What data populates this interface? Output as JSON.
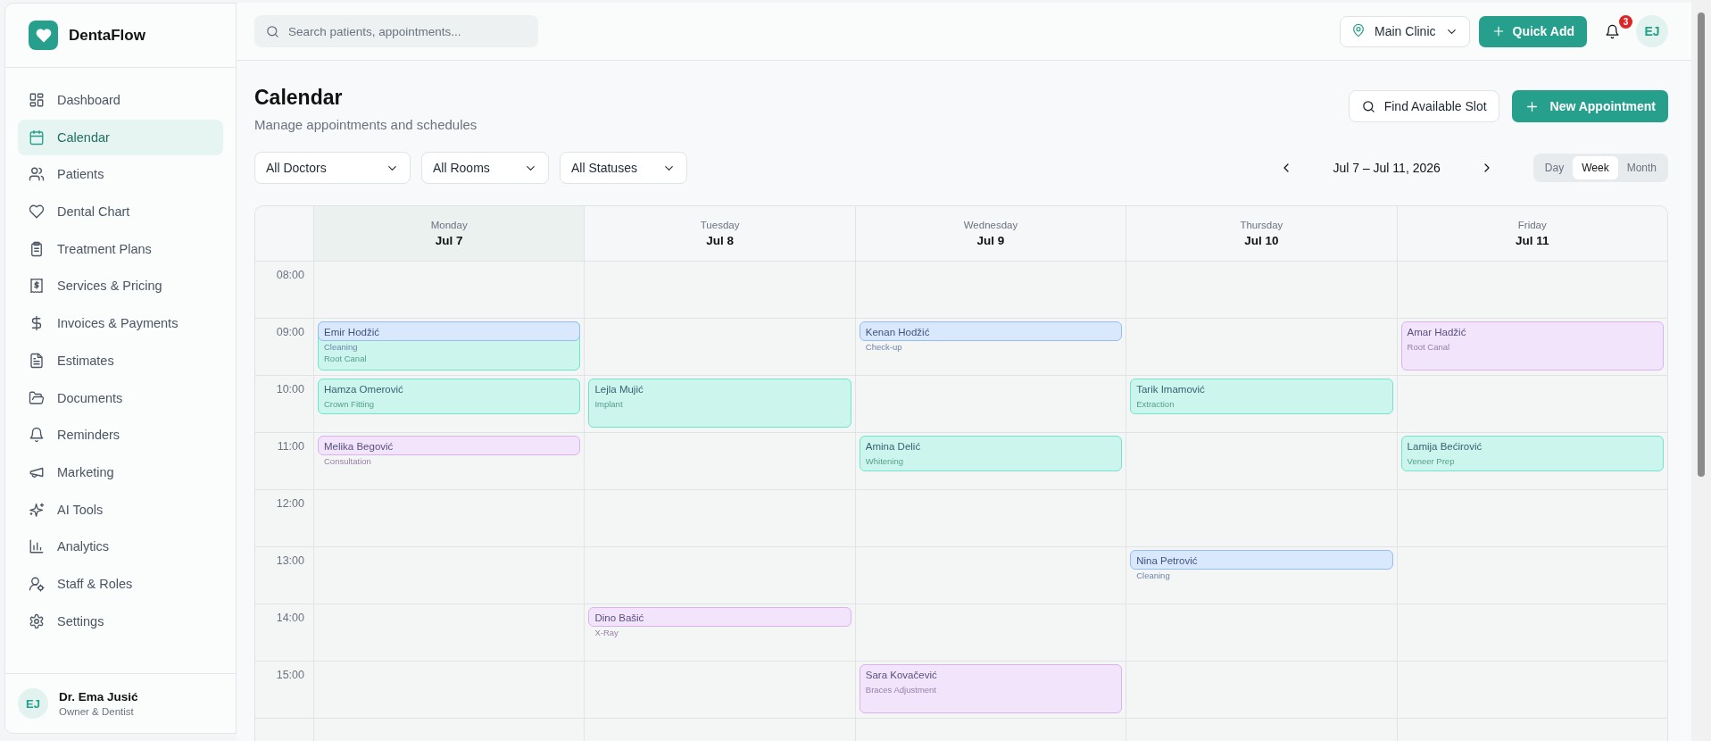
{
  "brand": {
    "name": "DentaFlow"
  },
  "sidebar": {
    "items": [
      {
        "label": "Dashboard",
        "selected": false
      },
      {
        "label": "Calendar",
        "selected": true
      },
      {
        "label": "Patients",
        "selected": false
      },
      {
        "label": "Dental Chart",
        "selected": false
      },
      {
        "label": "Treatment Plans",
        "selected": false
      },
      {
        "label": "Services & Pricing",
        "selected": false
      },
      {
        "label": "Invoices & Payments",
        "selected": false
      },
      {
        "label": "Estimates",
        "selected": false
      },
      {
        "label": "Documents",
        "selected": false
      },
      {
        "label": "Reminders",
        "selected": false
      },
      {
        "label": "Marketing",
        "selected": false
      },
      {
        "label": "AI Tools",
        "selected": false
      },
      {
        "label": "Analytics",
        "selected": false
      },
      {
        "label": "Staff & Roles",
        "selected": false
      },
      {
        "label": "Settings",
        "selected": false
      }
    ],
    "user": {
      "initials": "EJ",
      "name": "Dr. Ema Jusić",
      "role": "Owner & Dentist"
    }
  },
  "topbar": {
    "search": {
      "placeholder": "Search patients, appointments..."
    },
    "location": "Main Clinic",
    "quick_add": "Quick Add",
    "notifications": "3",
    "avatar": "EJ"
  },
  "page": {
    "title": "Calendar",
    "subtitle": "Manage appointments and schedules",
    "find_slot": "Find Available Slot",
    "new_appointment": "New Appointment"
  },
  "filters": [
    "All Doctors",
    "All Rooms",
    "All Statuses"
  ],
  "range": "Jul 7 – Jul 11, 2026",
  "views": [
    {
      "label": "Day",
      "selected": false
    },
    {
      "label": "Week",
      "selected": true
    },
    {
      "label": "Month",
      "selected": false
    }
  ],
  "days": [
    {
      "weekday": "Monday",
      "date": "Jul 7",
      "today": true
    },
    {
      "weekday": "Tuesday",
      "date": "Jul 8",
      "today": false
    },
    {
      "weekday": "Wednesday",
      "date": "Jul 9",
      "today": false
    },
    {
      "weekday": "Thursday",
      "date": "Jul 10",
      "today": false
    },
    {
      "weekday": "Friday",
      "date": "Jul 11",
      "today": false
    }
  ],
  "hours": [
    {
      "time": "08:00",
      "cells": [
        {},
        {},
        {},
        {},
        {}
      ]
    },
    {
      "time": "09:00",
      "cells": [
        {
          "appointments": [
            {
              "name": "Emir Hodžić",
              "service": "Cleaning",
              "color": "#93bdf7",
              "short": true,
              "long": false
            },
            {
              "service": "Root Canal",
              "color": "#6ee5cc",
              "short": false,
              "long": true
            }
          ]
        },
        {},
        {
          "appointments": [
            {
              "name": "Kenan Hodžić",
              "service": "Check-up",
              "color": "#93bdf7",
              "short": true,
              "long": false
            }
          ]
        },
        {},
        {
          "appointments": [
            {
              "name": "Amar Hadžić",
              "service": "Root Canal",
              "color": "#dab1f3",
              "short": false,
              "long": true
            }
          ]
        }
      ]
    },
    {
      "time": "10:00",
      "cells": [
        {
          "appointments": [
            {
              "name": "Hamza Omerović",
              "service": "Crown Fitting",
              "color": "#6ee5cc",
              "short": false,
              "long": false
            }
          ]
        },
        {
          "appointments": [
            {
              "name": "Lejla Mujić",
              "service": "Implant",
              "color": "#6ee5cc",
              "short": false,
              "long": true
            }
          ]
        },
        {},
        {
          "appointments": [
            {
              "name": "Tarik Imamović",
              "service": "Extraction",
              "color": "#6ee5cc",
              "short": false,
              "long": false
            }
          ]
        },
        {}
      ]
    },
    {
      "time": "11:00",
      "cells": [
        {
          "appointments": [
            {
              "name": "Melika Begović",
              "service": "Consultation",
              "color": "#dab1f3",
              "short": true,
              "long": false
            }
          ]
        },
        {},
        {
          "appointments": [
            {
              "name": "Amina Delić",
              "service": "Whitening",
              "color": "#6ee5cc",
              "short": false,
              "long": false
            }
          ]
        },
        {},
        {
          "appointments": [
            {
              "name": "Lamija Bećirović",
              "service": "Veneer Prep",
              "color": "#6ee5cc",
              "short": false,
              "long": false
            }
          ]
        }
      ]
    },
    {
      "time": "12:00",
      "cells": [
        {},
        {},
        {},
        {},
        {}
      ]
    },
    {
      "time": "13:00",
      "cells": [
        {},
        {},
        {},
        {
          "appointments": [
            {
              "name": "Nina Petrović",
              "service": "Cleaning",
              "color": "#93bdf7",
              "short": true,
              "long": false
            }
          ]
        },
        {}
      ]
    },
    {
      "time": "14:00",
      "cells": [
        {},
        {
          "appointments": [
            {
              "name": "Dino Bašić",
              "service": "X-Ray",
              "color": "#dab1f3",
              "short": true,
              "long": false
            }
          ]
        },
        {},
        {},
        {}
      ]
    },
    {
      "time": "15:00",
      "cells": [
        {},
        {},
        {
          "appointments": [
            {
              "name": "Sara Kovačević",
              "service": "Braces Adjustment",
              "color": "#dab1f3",
              "short": false,
              "long": true
            }
          ]
        },
        {},
        {}
      ]
    },
    {
      "cells": [
        {},
        {},
        {},
        {},
        {}
      ]
    }
  ]
}
